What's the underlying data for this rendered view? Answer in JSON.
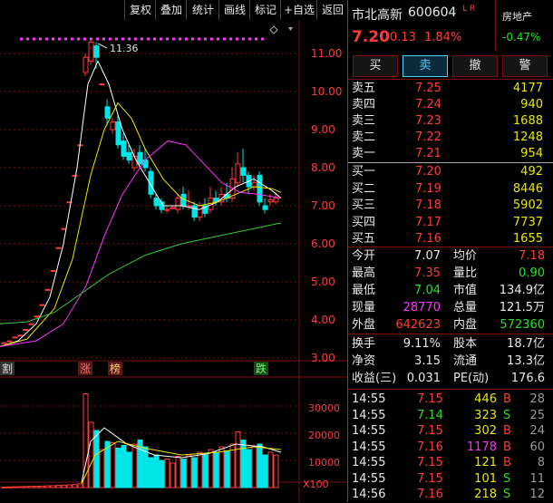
{
  "toolbar": {
    "items": [
      "复权",
      "叠加",
      "统计",
      "画线",
      "标记",
      "+自选",
      "返回"
    ]
  },
  "chart": {
    "price_axis": [
      "11.00",
      "10.00",
      "9.00",
      "8.00",
      "7.00",
      "6.00",
      "5.00",
      "4.00",
      "3.00"
    ],
    "high_label": "11.36",
    "markers": {
      "zhang": "涨",
      "bang": "榜",
      "die": "跌",
      "left": "割"
    },
    "vol_axis": [
      "30000",
      "20000",
      "10000"
    ],
    "vol_unit": "X100",
    "colors": {
      "up": "#ff3b3b",
      "down": "#00e5e5",
      "ma5": "#ffffff",
      "ma10": "#e8e800",
      "ma20": "#ff33ff",
      "ma60": "#33cc33",
      "grid": "#7a1010"
    }
  },
  "quote": {
    "name": "市北高新",
    "code": "600604",
    "tags": "L R",
    "sector": "房地产",
    "sector_change": "-0.47%",
    "price": "7.20",
    "change": "0.13",
    "change_pct": "1.84%"
  },
  "actions": [
    "买",
    "卖",
    "撤",
    "警"
  ],
  "asks": [
    {
      "label": "卖五",
      "price": "7.25",
      "vol": "4177"
    },
    {
      "label": "卖四",
      "price": "7.24",
      "vol": "940"
    },
    {
      "label": "卖三",
      "price": "7.23",
      "vol": "1688"
    },
    {
      "label": "卖二",
      "price": "7.22",
      "vol": "1248"
    },
    {
      "label": "卖一",
      "price": "7.21",
      "vol": "954"
    }
  ],
  "bids": [
    {
      "label": "买一",
      "price": "7.20",
      "vol": "492"
    },
    {
      "label": "买二",
      "price": "7.19",
      "vol": "8446"
    },
    {
      "label": "买三",
      "price": "7.18",
      "vol": "5902"
    },
    {
      "label": "买四",
      "price": "7.17",
      "vol": "7737"
    },
    {
      "label": "买五",
      "price": "7.16",
      "vol": "1655"
    }
  ],
  "stats": [
    {
      "l1": "今开",
      "v1": "7.07",
      "l2": "均价",
      "v2": "7.18"
    },
    {
      "l1": "最高",
      "v1": "7.35",
      "l2": "量比",
      "v2": "0.90"
    },
    {
      "l1": "最低",
      "v1": "7.04",
      "l2": "市值",
      "v2": "134.9亿"
    },
    {
      "l1": "现量",
      "v1": "28770",
      "l2": "总量",
      "v2": "121.5万"
    },
    {
      "l1": "外盘",
      "v1": "642623",
      "l2": "内盘",
      "v2": "572360"
    }
  ],
  "stats2": [
    {
      "l1": "换手",
      "v1": "9.11%",
      "l2": "股本",
      "v2": "18.7亿"
    },
    {
      "l1": "净资",
      "v1": "3.15",
      "l2": "流通",
      "v2": "13.3亿"
    },
    {
      "l1": "收益(三)",
      "v1": "0.031",
      "l2": "PE(动)",
      "v2": "176.6"
    }
  ],
  "ticks": [
    {
      "time": "14:55",
      "price": "7.15",
      "vol": "446",
      "side": "B",
      "num": "28"
    },
    {
      "time": "14:55",
      "price": "7.14",
      "vol": "323",
      "side": "S",
      "num": "25"
    },
    {
      "time": "14:55",
      "price": "7.15",
      "vol": "302",
      "side": "B",
      "num": "24"
    },
    {
      "time": "14:55",
      "price": "7.16",
      "vol": "1178",
      "side": "B",
      "num": "60"
    },
    {
      "time": "14:55",
      "price": "7.15",
      "vol": "121",
      "side": "B",
      "num": "8"
    },
    {
      "time": "14:55",
      "price": "7.15",
      "vol": "101",
      "side": "S",
      "num": "11"
    },
    {
      "time": "14:56",
      "price": "7.16",
      "vol": "218",
      "side": "S",
      "num": "12"
    }
  ]
}
